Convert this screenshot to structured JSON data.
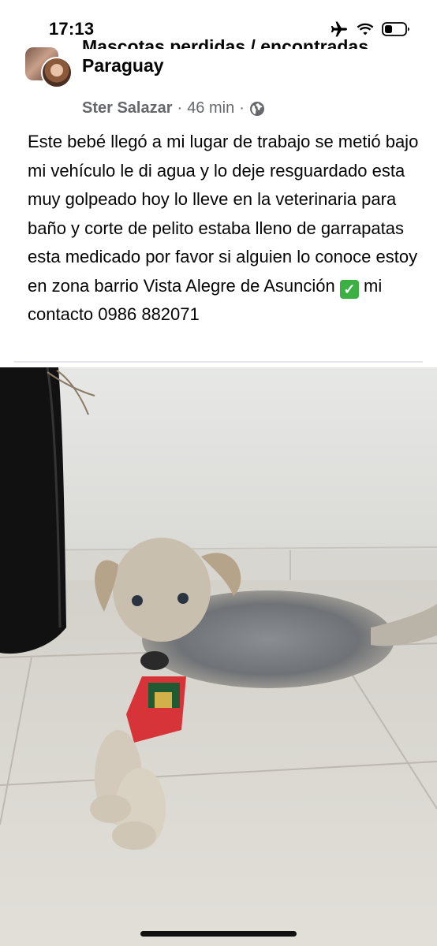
{
  "status_bar": {
    "time": "17:13",
    "icons": [
      "airplane-icon",
      "wifi-icon",
      "battery-icon"
    ]
  },
  "post": {
    "group_name_line1": "Mascotas perdidas / encontradas",
    "group_name_line2": "Paraguay",
    "author": "Ster Salazar",
    "separator": "·",
    "time_ago": "46 min",
    "privacy_icon": "globe-icon",
    "text_main": "Este bebé llegó a mi lugar de trabajo se metió bajo mi vehículo le di agua y lo deje resguardado esta muy golpeado hoy lo lleve en la veterinaria para baño y corte de pelito estaba lleno de garrapatas  esta medicado por favor si alguien lo conoce estoy en zona barrio Vista Alegre de Asunción",
    "text_emoji": "✓",
    "text_tail": "mi contacto 0986 882071"
  },
  "colors": {
    "text": "#050505",
    "secondary_text": "#65676b",
    "divider": "#e4e6eb"
  }
}
